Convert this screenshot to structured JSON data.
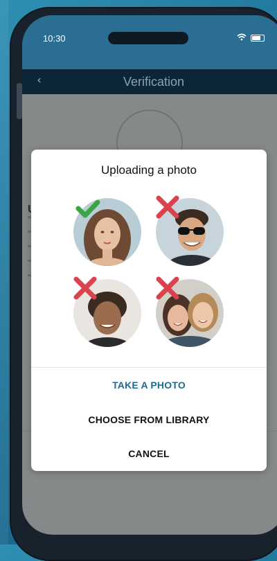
{
  "status_bar": {
    "time": "10:30"
  },
  "nav": {
    "back": "‹",
    "title": "Verification"
  },
  "background": {
    "heading_letter": "U"
  },
  "dialog": {
    "title": "Uploading a photo",
    "photos": [
      {
        "status": "accepted",
        "mark_icon": "check-icon"
      },
      {
        "status": "rejected",
        "mark_icon": "cross-icon"
      },
      {
        "status": "rejected",
        "mark_icon": "cross-icon"
      },
      {
        "status": "rejected",
        "mark_icon": "cross-icon"
      }
    ],
    "actions": {
      "take_photo": "TAKE A PHOTO",
      "choose_library": "CHOOSE FROM LIBRARY",
      "cancel": "CANCEL"
    }
  },
  "colors": {
    "accent": "#1f6a8e",
    "check": "#3aa544",
    "cross": "#d8434d",
    "nav_bg": "#0c2638"
  }
}
